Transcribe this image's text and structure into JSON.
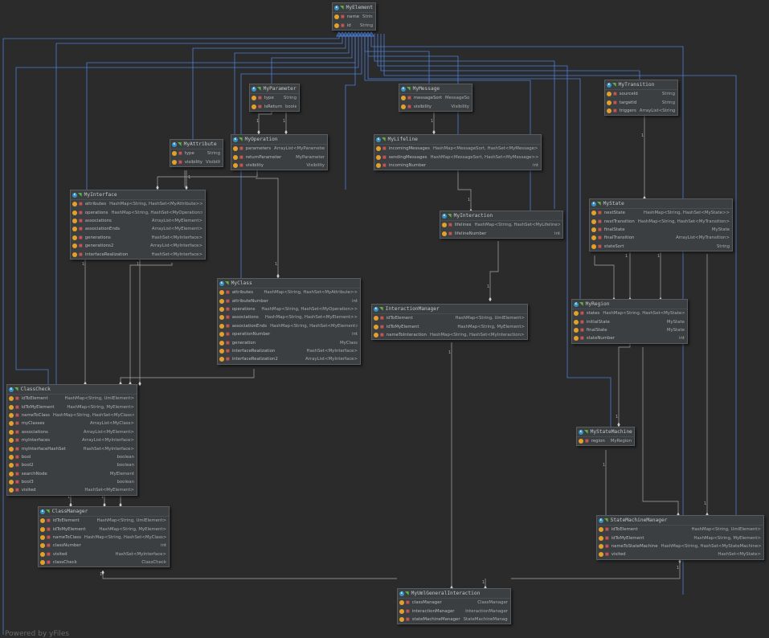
{
  "classes": {
    "MyElement": {
      "name": "MyElement",
      "fields": [
        {
          "name": "name",
          "type": "String"
        },
        {
          "name": "id",
          "type": "String"
        }
      ]
    },
    "MyParameter": {
      "name": "MyParameter",
      "fields": [
        {
          "name": "type",
          "type": "String"
        },
        {
          "name": "isReturn",
          "type": "boolean"
        }
      ]
    },
    "MyMessage": {
      "name": "MyMessage",
      "fields": [
        {
          "name": "messageSort",
          "type": "MessageSort"
        },
        {
          "name": "visibility",
          "type": "Visibility"
        }
      ]
    },
    "MyTransition": {
      "name": "MyTransition",
      "fields": [
        {
          "name": "sourceId",
          "type": "String"
        },
        {
          "name": "targetId",
          "type": "String"
        },
        {
          "name": "triggers",
          "type": "ArrayList<String>"
        }
      ]
    },
    "MyAttribute": {
      "name": "MyAttribute",
      "fields": [
        {
          "name": "type",
          "type": "String"
        },
        {
          "name": "visibility",
          "type": "Visibility"
        }
      ]
    },
    "MyOperation": {
      "name": "MyOperation",
      "fields": [
        {
          "name": "parameters",
          "type": "ArrayList<MyParameter>"
        },
        {
          "name": "returnParameter",
          "type": "MyParameter"
        },
        {
          "name": "visibility",
          "type": "Visibility"
        }
      ]
    },
    "MyLifeline": {
      "name": "MyLifeline",
      "fields": [
        {
          "name": "incomingMessages",
          "type": "HashMap<MessageSort, HashSet<MyMessage>>"
        },
        {
          "name": "sendingMessages",
          "type": "HashMap<MessageSort, HashSet<MyMessage>>"
        },
        {
          "name": "incomingNumber",
          "type": "int"
        }
      ]
    },
    "MyInterface": {
      "name": "MyInterface",
      "fields": [
        {
          "name": "attributes",
          "type": "HashMap<String, HashSet<MyAttribute>>"
        },
        {
          "name": "operations",
          "type": "HashMap<String, HashSet<MyOperation>>"
        },
        {
          "name": "associations",
          "type": "ArrayList<MyElement>"
        },
        {
          "name": "associationEnds",
          "type": "ArrayList<MyElement>"
        },
        {
          "name": "generations",
          "type": "HashSet<MyInterface>"
        },
        {
          "name": "generations2",
          "type": "ArrayList<MyInterface>"
        },
        {
          "name": "interfaceRealization",
          "type": "HashSet<MyInterface>"
        }
      ]
    },
    "MyState": {
      "name": "MyState",
      "fields": [
        {
          "name": "nextState",
          "type": "HashMap<String, HashSet<MyState>>"
        },
        {
          "name": "nextTransition",
          "type": "HashMap<String, HashSet<MyTransition>>"
        },
        {
          "name": "finalState",
          "type": "MyState"
        },
        {
          "name": "finalTransition",
          "type": "ArrayList<MyTransition>"
        },
        {
          "name": "stateSort",
          "type": "String"
        }
      ]
    },
    "MyInteraction": {
      "name": "MyInteraction",
      "fields": [
        {
          "name": "lifelines",
          "type": "HashMap<String, HashSet<MyLifeline>>"
        },
        {
          "name": "lifelineNumber",
          "type": "int"
        }
      ]
    },
    "MyClass": {
      "name": "MyClass",
      "fields": [
        {
          "name": "attributes",
          "type": "HashMap<String, HashSet<MyAttribute>>"
        },
        {
          "name": "attributeNumber",
          "type": "int"
        },
        {
          "name": "operations",
          "type": "HashMap<String, HashSet<MyOperation>>"
        },
        {
          "name": "associations",
          "type": "HashMap<String, HashSet<MyElement>>"
        },
        {
          "name": "associationEnds",
          "type": "HashMap<String, HashSet<MyElement>>"
        },
        {
          "name": "operationNumber",
          "type": "int"
        },
        {
          "name": "generation",
          "type": "MyClass"
        },
        {
          "name": "interfaceRealization",
          "type": "HashSet<MyInterface>"
        },
        {
          "name": "interfaceRealization2",
          "type": "ArrayList<MyInterface>"
        }
      ]
    },
    "InteractionManager": {
      "name": "InteractionManager",
      "fields": [
        {
          "name": "idToElement",
          "type": "HashMap<String, UmlElement>"
        },
        {
          "name": "idToMyElement",
          "type": "HashMap<String, MyElement>"
        },
        {
          "name": "nameToInteraction",
          "type": "HashMap<String, HashSet<MyInteraction>>"
        }
      ]
    },
    "MyRegion": {
      "name": "MyRegion",
      "fields": [
        {
          "name": "states",
          "type": "HashMap<String, HashSet<MyState>>"
        },
        {
          "name": "initialState",
          "type": "MyState"
        },
        {
          "name": "finalState",
          "type": "MyState"
        },
        {
          "name": "stateNumber",
          "type": "int"
        }
      ]
    },
    "ClassCheck": {
      "name": "ClassCheck",
      "fields": [
        {
          "name": "idToElement",
          "type": "HashMap<String, UmlElement>"
        },
        {
          "name": "idToMyElement",
          "type": "HashMap<String, MyElement>"
        },
        {
          "name": "nameToClass",
          "type": "HashMap<String, HashSet<MyClass>>"
        },
        {
          "name": "myClasses",
          "type": "ArrayList<MyClass>"
        },
        {
          "name": "associations",
          "type": "ArrayList<MyElement>"
        },
        {
          "name": "myInterfaces",
          "type": "ArrayList<MyInterface>"
        },
        {
          "name": "myInterfaceHashSet",
          "type": "HashSet<MyInterface>"
        },
        {
          "name": "bool",
          "type": "boolean"
        },
        {
          "name": "bool2",
          "type": "boolean"
        },
        {
          "name": "searchNode",
          "type": "MyElement"
        },
        {
          "name": "bool3",
          "type": "boolean"
        },
        {
          "name": "visited",
          "type": "HashSet<MyElement>"
        }
      ]
    },
    "MyStateMachine": {
      "name": "MyStateMachine",
      "fields": [
        {
          "name": "region",
          "type": "MyRegion"
        }
      ]
    },
    "ClassManager": {
      "name": "ClassManager",
      "fields": [
        {
          "name": "idToElement",
          "type": "HashMap<String, UmlElement>"
        },
        {
          "name": "idToMyElement",
          "type": "HashMap<String, MyElement>"
        },
        {
          "name": "nameToClass",
          "type": "HashMap<String, HashSet<MyClass>>"
        },
        {
          "name": "classNumber",
          "type": "int"
        },
        {
          "name": "visited",
          "type": "HashSet<MyInterface>"
        },
        {
          "name": "classCheck",
          "type": "ClassCheck"
        }
      ]
    },
    "StateMachineManager": {
      "name": "StateMachineManager",
      "fields": [
        {
          "name": "idToElement",
          "type": "HashMap<String, UmlElement>"
        },
        {
          "name": "idToMyElement",
          "type": "HashMap<String, MyElement>"
        },
        {
          "name": "nameToStateMachine",
          "type": "HashMap<String, HashSet<MyStateMachine>>"
        },
        {
          "name": "visited",
          "type": "HashSet<MyState>"
        }
      ]
    },
    "MyUmlGeneralInteraction": {
      "name": "MyUmlGeneralInteraction",
      "fields": [
        {
          "name": "classManager",
          "type": "ClassManager"
        },
        {
          "name": "interactionManager",
          "type": "InteractionManager"
        },
        {
          "name": "stateMachineManager",
          "type": "StateMachineManager"
        }
      ]
    }
  },
  "cardinality_label": "1",
  "footer_text": "Powered by yFiles",
  "colors": {
    "background": "#2b2b2b",
    "inheritance_line": "#4a7fd9",
    "association_line": "#a8a8a8",
    "class_icon": "#3592c4",
    "field_icon": "#e3a12b"
  }
}
